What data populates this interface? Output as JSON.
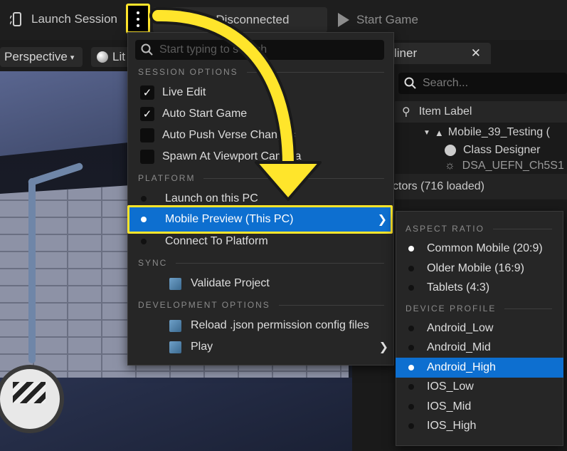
{
  "toolbar": {
    "launch_label": "Launch Session",
    "session_status": "Session Disconnected",
    "session_status_visible": "ssion Disconnected",
    "start_game_label": "Start Game"
  },
  "viewport": {
    "perspective_label": "Perspective",
    "lit_label": "Lit"
  },
  "outliner": {
    "tab_label": "liner",
    "search_placeholder": "Search...",
    "column_header": "Item Label",
    "rows": [
      "Mobile_39_Testing (",
      "Class Designer",
      "DSA_UEFN_Ch5S1"
    ],
    "actors_text": "ctors (716 loaded)"
  },
  "menu": {
    "search_placeholder": "Start typing to search",
    "sections": {
      "session_options": "SESSION OPTIONS",
      "platform": "PLATFORM",
      "sync": "SYNC",
      "development_options": "DEVELOPMENT OPTIONS"
    },
    "session_items": [
      {
        "label": "Live Edit",
        "checked": true
      },
      {
        "label": "Auto Start Game",
        "checked": true
      },
      {
        "label": "Auto Push Verse Changes",
        "checked": false
      },
      {
        "label": "Spawn At Viewport Camera",
        "checked": false
      }
    ],
    "platform_items": [
      {
        "label": "Launch on this PC",
        "selected": false
      },
      {
        "label": "Mobile Preview (This PC)",
        "selected": true
      },
      {
        "label": "Connect To Platform",
        "selected": false
      }
    ],
    "sync_items": [
      "Validate Project"
    ],
    "dev_items": [
      "Reload .json permission config files",
      "Play"
    ]
  },
  "submenu": {
    "aspect_ratio_header": "ASPECT RATIO",
    "aspect_items": [
      {
        "label": "Common Mobile (20:9)",
        "selected": true
      },
      {
        "label": "Older Mobile (16:9)",
        "selected": false
      },
      {
        "label": "Tablets (4:3)",
        "selected": false
      }
    ],
    "device_profile_header": "DEVICE PROFILE",
    "device_items": [
      {
        "label": "Android_Low",
        "selected": false
      },
      {
        "label": "Android_Mid",
        "selected": false
      },
      {
        "label": "Android_High",
        "selected": true
      },
      {
        "label": "IOS_Low",
        "selected": false
      },
      {
        "label": "IOS_Mid",
        "selected": false
      },
      {
        "label": "IOS_High",
        "selected": false
      }
    ]
  },
  "colors": {
    "highlight": "#0d6fd0",
    "callout": "#ffe52b"
  }
}
